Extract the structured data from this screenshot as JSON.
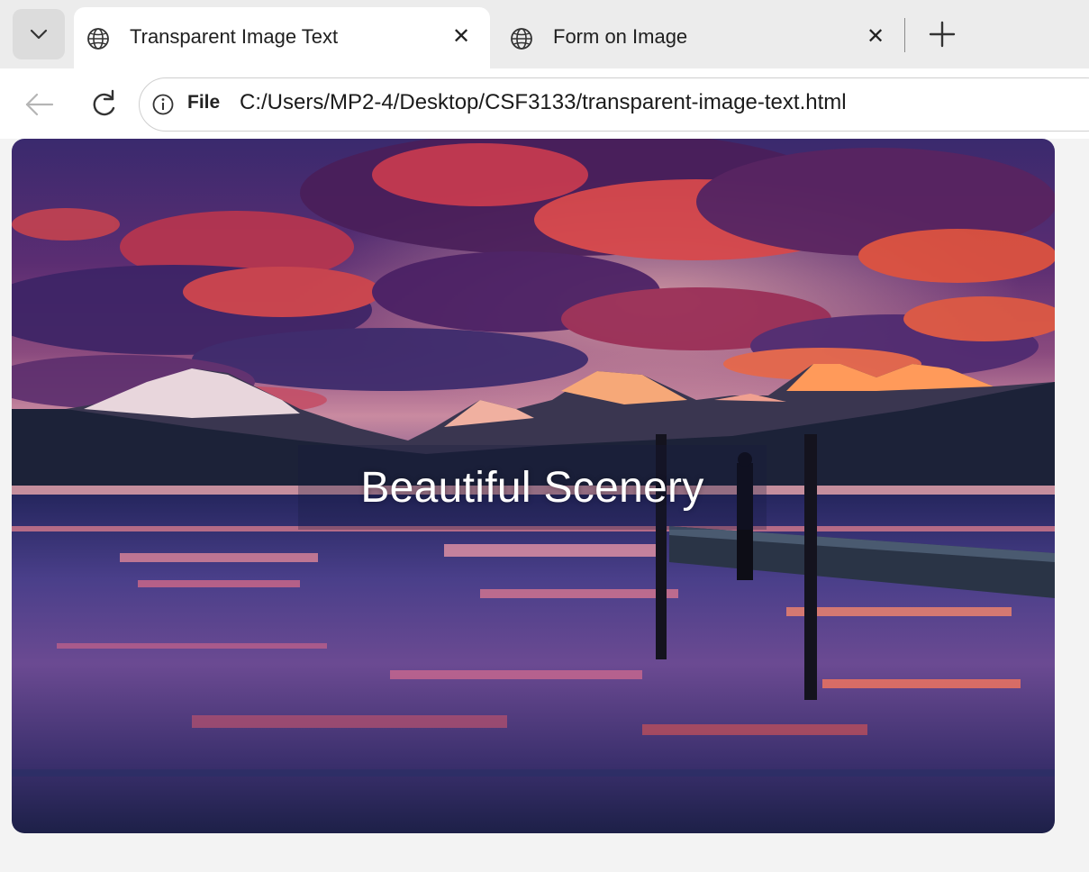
{
  "tabs": [
    {
      "title": "Transparent Image Text",
      "active": true
    },
    {
      "title": "Form on Image",
      "active": false
    }
  ],
  "icons": {
    "tab_menu": "chevron-down-icon",
    "tab_favicon": "globe-icon",
    "close": "close-icon",
    "new_tab": "plus-icon",
    "back": "back-arrow-icon",
    "reload": "reload-icon",
    "site_info": "info-icon"
  },
  "address_bar": {
    "scheme_label": "File",
    "url": "C:/Users/MP2-4/Desktop/CSF3133/transparent-image-text.html"
  },
  "page": {
    "caption": "Beautiful Scenery"
  },
  "colors": {
    "tab_strip": "#ececec",
    "active_tab": "#ffffff",
    "page_bg": "#f3f3f3"
  }
}
